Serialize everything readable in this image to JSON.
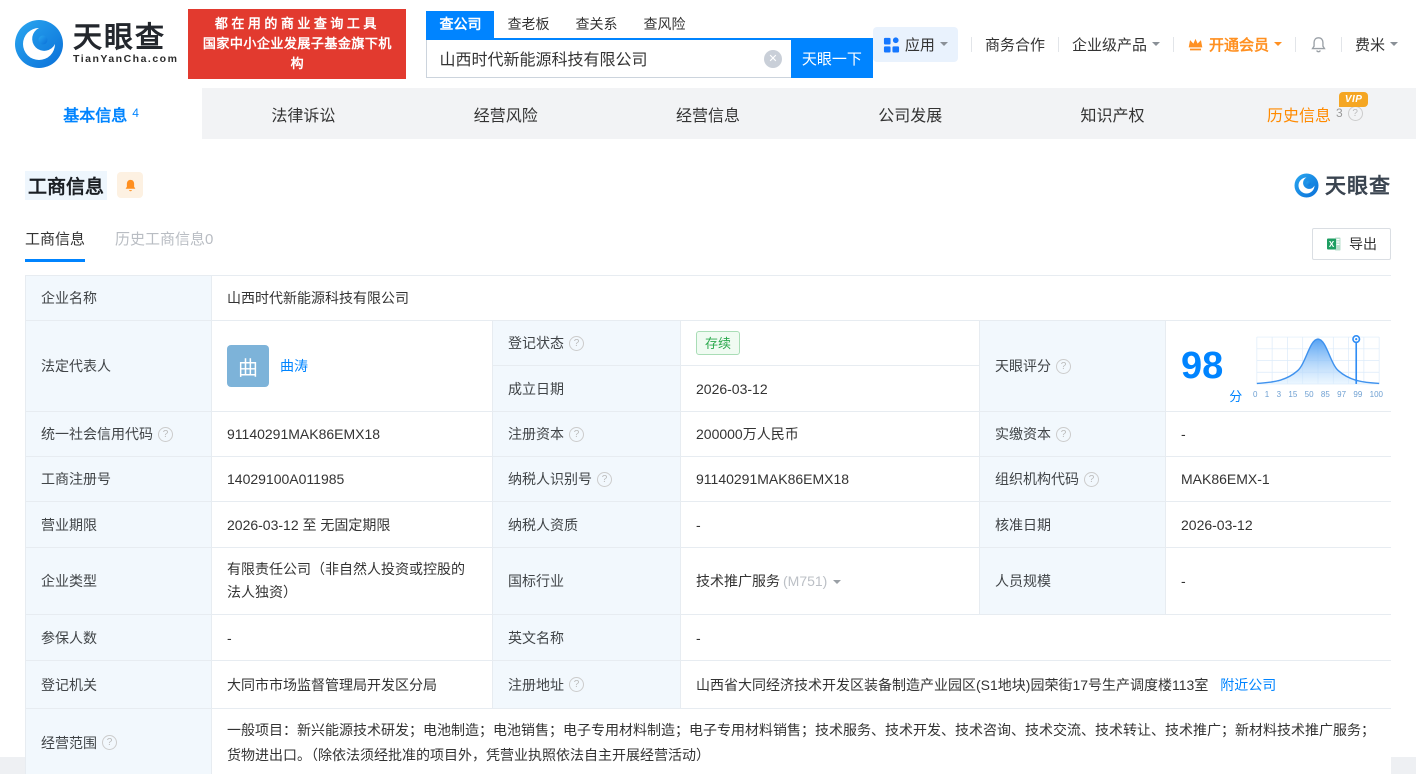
{
  "header": {
    "logo": {
      "brand": "天眼查",
      "domain": "TianYanCha.com"
    },
    "promo": {
      "line1": "都在用的商业查询工具",
      "line2": "国家中小企业发展子基金旗下机构"
    },
    "search": {
      "tabs": [
        {
          "label": "查公司",
          "active": true
        },
        {
          "label": "查老板",
          "active": false
        },
        {
          "label": "查关系",
          "active": false
        },
        {
          "label": "查风险",
          "active": false
        }
      ],
      "value": "山西时代新能源科技有限公司",
      "button": "天眼一下"
    },
    "nav": {
      "apps": "应用",
      "business": "商务合作",
      "enterprise": "企业级产品",
      "vip": "开通会员",
      "user": "费米"
    }
  },
  "tabs": [
    {
      "label": "基本信息",
      "count": "4",
      "active": true
    },
    {
      "label": "法律诉讼"
    },
    {
      "label": "经营风险"
    },
    {
      "label": "经营信息"
    },
    {
      "label": "公司发展"
    },
    {
      "label": "知识产权"
    },
    {
      "label": "历史信息",
      "count": "3",
      "vip_badge": "VIP"
    }
  ],
  "section": {
    "title": "工商信息",
    "watermark": "天眼查",
    "subtabs": [
      {
        "label": "工商信息",
        "active": true
      },
      {
        "label": "历史工商信息",
        "count": "0",
        "active": false
      }
    ],
    "export_label": "导出"
  },
  "table": {
    "company_name_label": "企业名称",
    "company_name": "山西时代新能源科技有限公司",
    "legal_rep_label": "法定代表人",
    "legal_rep_avatar": "曲",
    "legal_rep_name": "曲涛",
    "reg_status_label": "登记状态",
    "reg_status": "存续",
    "establish_date_label": "成立日期",
    "establish_date": "2026-03-12",
    "score_label": "天眼评分",
    "score": "98",
    "score_unit": "分",
    "credit_code_label": "统一社会信用代码",
    "credit_code": "91140291MAK86EMX18",
    "reg_capital_label": "注册资本",
    "reg_capital": "200000万人民币",
    "paid_capital_label": "实缴资本",
    "paid_capital": "-",
    "reg_number_label": "工商注册号",
    "reg_number": "14029100A011985",
    "taxpayer_id_label": "纳税人识别号",
    "taxpayer_id": "91140291MAK86EMX18",
    "org_code_label": "组织机构代码",
    "org_code": "MAK86EMX-1",
    "business_term_label": "营业期限",
    "business_term": "2026-03-12 至 无固定期限",
    "taxpayer_quality_label": "纳税人资质",
    "taxpayer_quality": "-",
    "approval_date_label": "核准日期",
    "approval_date": "2026-03-12",
    "company_type_label": "企业类型",
    "company_type": "有限责任公司（非自然人投资或控股的法人独资）",
    "industry_label": "国标行业",
    "industry": "技术推广服务",
    "industry_code": "(M751)",
    "staff_size_label": "人员规模",
    "staff_size": "-",
    "insured_label": "参保人数",
    "insured": "-",
    "english_name_label": "英文名称",
    "english_name": "-",
    "reg_authority_label": "登记机关",
    "reg_authority": "大同市市场监督管理局开发区分局",
    "address_label": "注册地址",
    "address": "山西省大同经济技术开发区装备制造产业园区(S1地块)园荣街17号生产调度楼113室",
    "nearby_link": "附近公司",
    "business_scope_label": "经营范围",
    "business_scope": "一般项目：新兴能源技术研发；电池制造；电池销售；电子专用材料制造；电子专用材料销售；技术服务、技术开发、技术咨询、技术交流、技术转让、技术推广；新材料技术推广服务；货物进出口。（除依法须经批准的项目外，凭营业执照依法自主开展经营活动）"
  },
  "score_chart": {
    "type": "area",
    "title": "天眼评分",
    "score": 98,
    "x_ticks": [
      "0",
      "1",
      "3",
      "15",
      "50",
      "85",
      "97",
      "99",
      "100"
    ],
    "marker_value": 98,
    "distribution": "bell-curve",
    "grid": true
  },
  "colors": {
    "accent": "#0084ff",
    "orange": "#ff9021",
    "red": "#e23a2f",
    "green": "#2ca94e"
  }
}
